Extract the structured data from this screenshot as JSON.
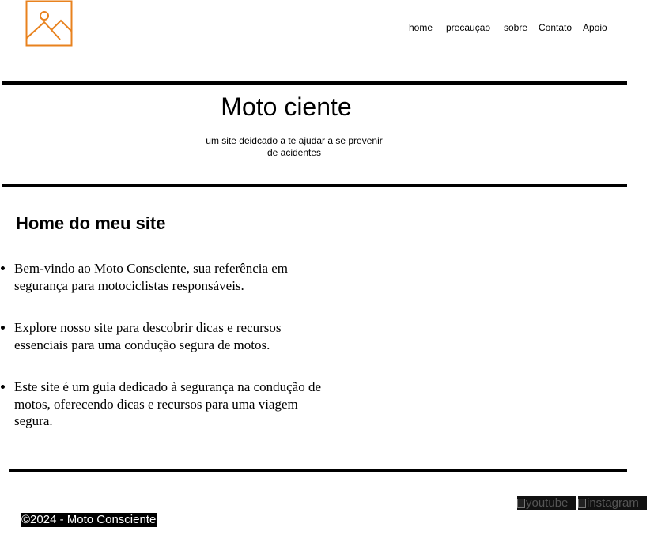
{
  "header": {
    "logo_icon": "image-placeholder-icon",
    "logo_color": "#E8821E",
    "nav": [
      {
        "label": "home"
      },
      {
        "label": "precauçao"
      },
      {
        "label": "sobre"
      },
      {
        "label": "Contato"
      },
      {
        "label": "Apoio"
      }
    ]
  },
  "hero": {
    "title": "Moto ciente",
    "subtitle": "um site deidcado a te ajudar a se prevenir de acidentes"
  },
  "main": {
    "heading": "Home do meu site",
    "items": [
      "Bem-vindo ao Moto Consciente, sua referência em segurança para motociclistas responsáveis.",
      "Explore nosso site para descobrir dicas e recursos essenciais para uma condução segura de motos.",
      "Este site é um guia dedicado à segurança na condução de motos, oferecendo dicas e recursos para uma viagem segura."
    ]
  },
  "footer": {
    "social": [
      {
        "alt": "youtube",
        "icon": "youtube-icon"
      },
      {
        "alt": "instagram",
        "icon": "instagram-icon"
      }
    ],
    "copyright": "©2024 - Moto Consciente"
  }
}
